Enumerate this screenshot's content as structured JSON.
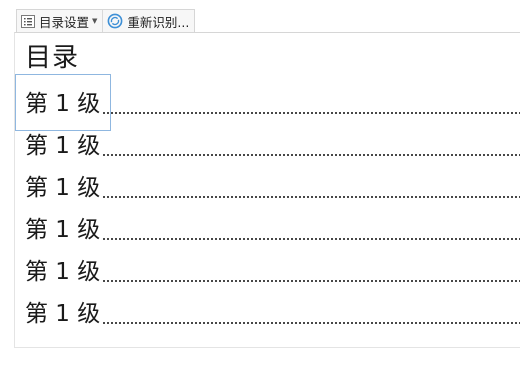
{
  "toolbar": {
    "toc_settings": {
      "label": "目录设置",
      "icon": "toc-list-icon"
    },
    "re_recognize": {
      "label": "重新识别...",
      "icon": "refresh-circle-icon"
    }
  },
  "toc": {
    "title": "目录",
    "entries": [
      {
        "text": "第 1 级"
      },
      {
        "text": "第 1 级"
      },
      {
        "text": "第 1 级"
      },
      {
        "text": "第 1 级"
      },
      {
        "text": "第 1 级"
      },
      {
        "text": "第 1 级"
      }
    ]
  },
  "colors": {
    "focus_border": "#8fb7e0",
    "refresh_icon": "#3d8fd6",
    "text": "#1a1a1a"
  }
}
